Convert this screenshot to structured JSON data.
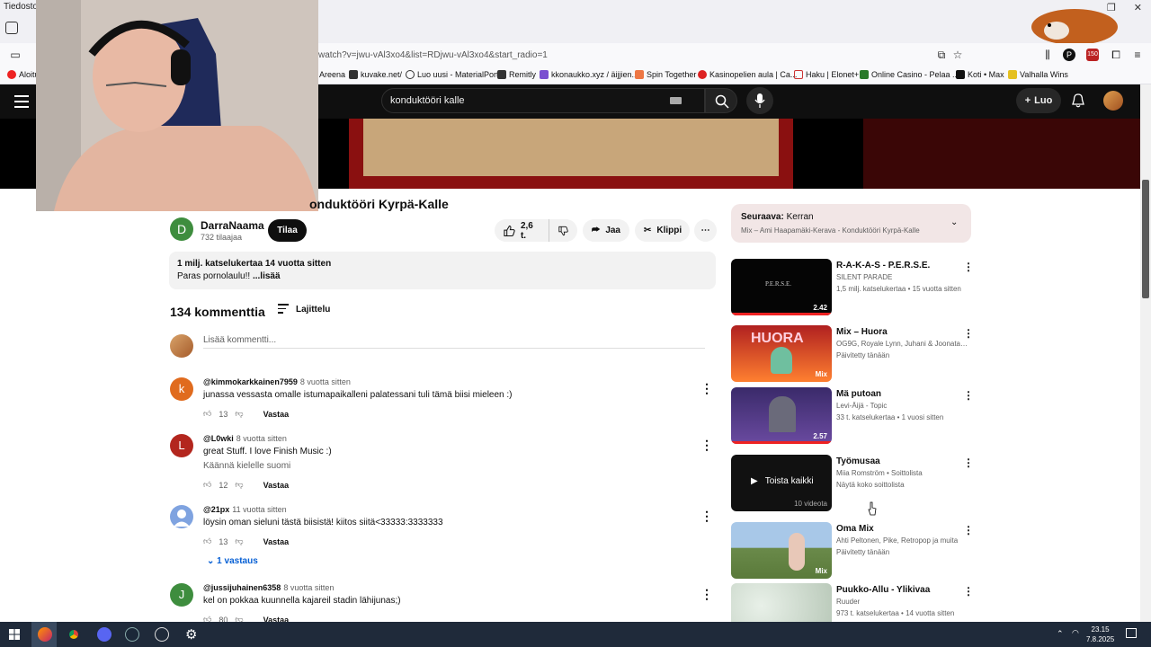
{
  "browser": {
    "title": "Tiedosto",
    "url": "watch?v=jwu-vAl3xo4&list=RDjwu-vAl3xo4&start_radio=1",
    "bookmarks": [
      "Aloitu",
      "Areena",
      "kuvake.net/",
      "Luo uusi - MaterialPort",
      "Remitly",
      "kkonaukko.xyz / äijjien...",
      "Spin Together",
      "Kasinopelien aula | Ca...",
      "Haku | Elonet+",
      "Online Casino - Pelaa ...",
      "Koti • Max",
      "Valhalla Wins"
    ],
    "badge_count": "150"
  },
  "header": {
    "search_query": "konduktööri kalle",
    "create_label": "Luo"
  },
  "video": {
    "title": "onduktööri Kyrpä-Kalle",
    "channel_initial": "D",
    "channel_name": "DarraNaama",
    "subscribers": "732 tilaajaa",
    "subscribe_label": "Tilaa",
    "likes": "2,6 t.",
    "share_label": "Jaa",
    "clip_label": "Klippi",
    "views_date": "1 milj. katselukertaa  14 vuotta sitten",
    "description": "Paras pornolaulu!! ",
    "more_label": "...lisää"
  },
  "comments": {
    "count_label": "134 kommenttia",
    "sort_label": "Lajittelu",
    "add_placeholder": "Lisää kommentti...",
    "reply_label": "Vastaa",
    "items": [
      {
        "initial": "k",
        "color": "#e06b1e",
        "author": "@kimmokarkkainen7959",
        "time": "8 vuotta sitten",
        "text": "junassa vessasta omalle istumapaikalleni palatessani tuli tämä biisi mieleen :)",
        "likes": "13"
      },
      {
        "initial": "L",
        "color": "#b3261e",
        "author": "@L0wki",
        "time": "8 vuotta sitten",
        "text": "great Stuff. I love Finish Music :)",
        "translate": "Käännä kielelle suomi",
        "likes": "12"
      },
      {
        "initial": "",
        "color": "#7fa3e0",
        "author": "@21px",
        "time": "11 vuotta sitten",
        "text": "löysin oman sieluni tästä biisistä! kiitos siitä<33333:3333333",
        "likes": "13",
        "replies": "1 vastaus"
      },
      {
        "initial": "J",
        "color": "#3e8d3e",
        "author": "@jussijuhainen6358",
        "time": "8 vuotta sitten",
        "text": "kel on pokkaa kuunnella kajareil stadin lähijunas;)",
        "likes": "80"
      }
    ]
  },
  "up_next": {
    "title_prefix": "Seuraava:",
    "title": "Kerran",
    "subtitle": "Mix – Ami Haapamäki-Kerava - Konduktööri Kyrpä-Kalle"
  },
  "recommendations": [
    {
      "title": "R-A-K-A-S - P.E.R.S.E.",
      "line1": "SILENT PARADE",
      "line2": "1,5 milj. katselukertaa • 15 vuotta sitten",
      "badge": "2.42",
      "thumb_text": "P.E.R.S.E."
    },
    {
      "title": "Mix – Huora",
      "line1": "OG9G, Royale Lynn, Juhani & Joonatan ja...",
      "line2": "Päivitetty tänään",
      "badge": "Mix",
      "thumb_text": "HUORA"
    },
    {
      "title": "Mä putoan",
      "line1": "Levi-Äijä - Topic",
      "line2": "33 t. katselukertaa • 1 vuosi sitten",
      "badge": "2.57"
    },
    {
      "title": "Työmusaa",
      "line1": "Miia Romström • Soittolista",
      "line2": "Näytä koko soittolista",
      "badge": "10 videota",
      "play_all": "Toista kaikki"
    },
    {
      "title": "Oma Mix",
      "line1": "Ahti Peltonen, Pike, Retropop ja muita",
      "line2": "Päivitetty tänään",
      "badge": "Mix"
    },
    {
      "title": "Puukko-Allu - Ylikivaa",
      "line1": "Ruuder",
      "line2": "973 t. katselukertaa • 14 vuotta sitten"
    }
  ],
  "taskbar": {
    "time": "23.15",
    "date": "7.8.2025"
  }
}
